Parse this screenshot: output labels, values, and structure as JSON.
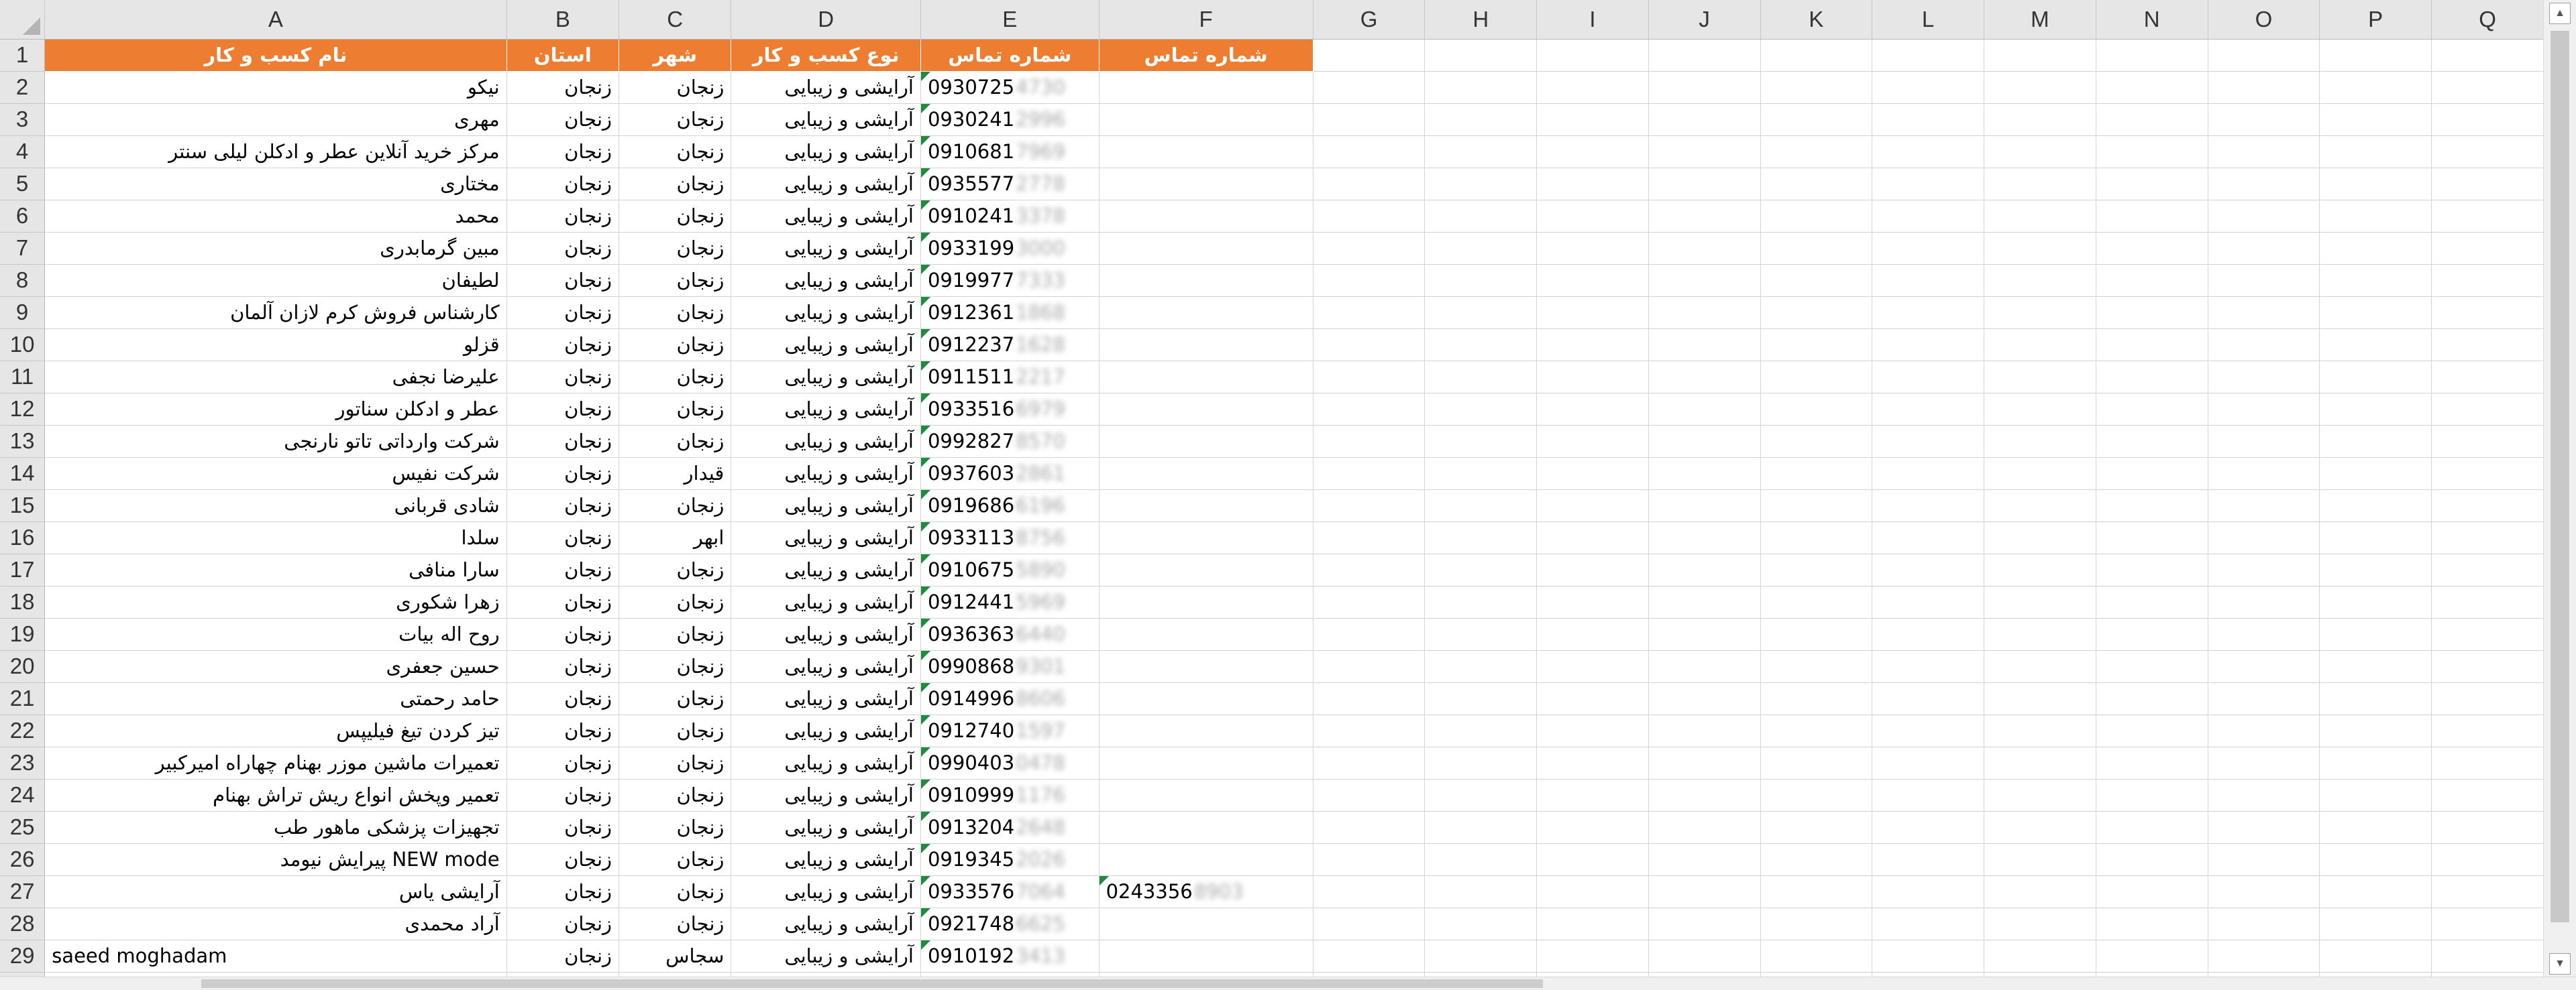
{
  "columns": [
    "A",
    "B",
    "C",
    "D",
    "E",
    "F",
    "G",
    "H",
    "I",
    "J",
    "K",
    "L",
    "M",
    "N",
    "O",
    "P",
    "Q"
  ],
  "selected_column": "A",
  "header_row": {
    "row_num": "1",
    "A": "نام کسب و کار",
    "B": "استان",
    "C": "شهر",
    "D": "نوع کسب و کار",
    "E": "شماره تماس",
    "F": "شماره تماس"
  },
  "rows": [
    {
      "num": "2",
      "name": "نیکو",
      "province": "زنجان",
      "city": "زنجان",
      "type": "آرایشی و زیبایی",
      "phone": "0930725",
      "phone_hidden": "4730",
      "phone2": "",
      "phone2_hidden": ""
    },
    {
      "num": "3",
      "name": "مهری",
      "province": "زنجان",
      "city": "زنجان",
      "type": "آرایشی و زیبایی",
      "phone": "0930241",
      "phone_hidden": "2996",
      "phone2": "",
      "phone2_hidden": ""
    },
    {
      "num": "4",
      "name": "مرکز خرید آنلاین عطر و ادکلن لیلی سنتر",
      "province": "زنجان",
      "city": "زنجان",
      "type": "آرایشی و زیبایی",
      "phone": "0910681",
      "phone_hidden": "7969",
      "phone2": "",
      "phone2_hidden": ""
    },
    {
      "num": "5",
      "name": "مختاری",
      "province": "زنجان",
      "city": "زنجان",
      "type": "آرایشی و زیبایی",
      "phone": "0935577",
      "phone_hidden": "2778",
      "phone2": "",
      "phone2_hidden": ""
    },
    {
      "num": "6",
      "name": "محمد",
      "province": "زنجان",
      "city": "زنجان",
      "type": "آرایشی و زیبایی",
      "phone": "0910241",
      "phone_hidden": "3378",
      "phone2": "",
      "phone2_hidden": ""
    },
    {
      "num": "7",
      "name": "مبین گرمابدری",
      "province": "زنجان",
      "city": "زنجان",
      "type": "آرایشی و زیبایی",
      "phone": "0933199",
      "phone_hidden": "3000",
      "phone2": "",
      "phone2_hidden": ""
    },
    {
      "num": "8",
      "name": "لطیفان",
      "province": "زنجان",
      "city": "زنجان",
      "type": "آرایشی و زیبایی",
      "phone": "0919977",
      "phone_hidden": "7333",
      "phone2": "",
      "phone2_hidden": ""
    },
    {
      "num": "9",
      "name": "کارشناس فروش کرم لازان آلمان",
      "province": "زنجان",
      "city": "زنجان",
      "type": "آرایشی و زیبایی",
      "phone": "0912361",
      "phone_hidden": "1868",
      "phone2": "",
      "phone2_hidden": ""
    },
    {
      "num": "10",
      "name": "قزلو",
      "province": "زنجان",
      "city": "زنجان",
      "type": "آرایشی و زیبایی",
      "phone": "0912237",
      "phone_hidden": "1628",
      "phone2": "",
      "phone2_hidden": ""
    },
    {
      "num": "11",
      "name": "علیرضا نجفی",
      "province": "زنجان",
      "city": "زنجان",
      "type": "آرایشی و زیبایی",
      "phone": "0911511",
      "phone_hidden": "2217",
      "phone2": "",
      "phone2_hidden": ""
    },
    {
      "num": "12",
      "name": "عطر و ادکلن سناتور",
      "province": "زنجان",
      "city": "زنجان",
      "type": "آرایشی و زیبایی",
      "phone": "0933516",
      "phone_hidden": "6979",
      "phone2": "",
      "phone2_hidden": ""
    },
    {
      "num": "13",
      "name": "شرکت وارداتی تاتو نارنجی",
      "province": "زنجان",
      "city": "زنجان",
      "type": "آرایشی و زیبایی",
      "phone": "0992827",
      "phone_hidden": "8570",
      "phone2": "",
      "phone2_hidden": ""
    },
    {
      "num": "14",
      "name": "شرکت نفیس",
      "province": "زنجان",
      "city": "قیدار",
      "type": "آرایشی و زیبایی",
      "phone": "0937603",
      "phone_hidden": "2861",
      "phone2": "",
      "phone2_hidden": ""
    },
    {
      "num": "15",
      "name": "شادی قربانی",
      "province": "زنجان",
      "city": "زنجان",
      "type": "آرایشی و زیبایی",
      "phone": "0919686",
      "phone_hidden": "6196",
      "phone2": "",
      "phone2_hidden": ""
    },
    {
      "num": "16",
      "name": "سلدا",
      "province": "زنجان",
      "city": "ابهر",
      "type": "آرایشی و زیبایی",
      "phone": "0933113",
      "phone_hidden": "8756",
      "phone2": "",
      "phone2_hidden": ""
    },
    {
      "num": "17",
      "name": "سارا منافی",
      "province": "زنجان",
      "city": "زنجان",
      "type": "آرایشی و زیبایی",
      "phone": "0910675",
      "phone_hidden": "5890",
      "phone2": "",
      "phone2_hidden": ""
    },
    {
      "num": "18",
      "name": "زهرا شکوری",
      "province": "زنجان",
      "city": "زنجان",
      "type": "آرایشی و زیبایی",
      "phone": "0912441",
      "phone_hidden": "5969",
      "phone2": "",
      "phone2_hidden": ""
    },
    {
      "num": "19",
      "name": "روح اله بیات",
      "province": "زنجان",
      "city": "زنجان",
      "type": "آرایشی و زیبایی",
      "phone": "0936363",
      "phone_hidden": "6440",
      "phone2": "",
      "phone2_hidden": ""
    },
    {
      "num": "20",
      "name": "حسین جعفری",
      "province": "زنجان",
      "city": "زنجان",
      "type": "آرایشی و زیبایی",
      "phone": "0990868",
      "phone_hidden": "9301",
      "phone2": "",
      "phone2_hidden": ""
    },
    {
      "num": "21",
      "name": "حامد رحمتی",
      "province": "زنجان",
      "city": "زنجان",
      "type": "آرایشی و زیبایی",
      "phone": "0914996",
      "phone_hidden": "8606",
      "phone2": "",
      "phone2_hidden": ""
    },
    {
      "num": "22",
      "name": "تیز کردن تیغ فیلیپس",
      "province": "زنجان",
      "city": "زنجان",
      "type": "آرایشی و زیبایی",
      "phone": "0912740",
      "phone_hidden": "1597",
      "phone2": "",
      "phone2_hidden": ""
    },
    {
      "num": "23",
      "name": "تعمیرات ماشین موزر بهنام چهاراه امیرکبیر",
      "province": "زنجان",
      "city": "زنجان",
      "type": "آرایشی و زیبایی",
      "phone": "0990403",
      "phone_hidden": "0478",
      "phone2": "",
      "phone2_hidden": ""
    },
    {
      "num": "24",
      "name": "تعمیر وپخش انواع ریش تراش بهنام",
      "province": "زنجان",
      "city": "زنجان",
      "type": "آرایشی و زیبایی",
      "phone": "0910999",
      "phone_hidden": "1176",
      "phone2": "",
      "phone2_hidden": ""
    },
    {
      "num": "25",
      "name": "تجهیزات پزشکی ماهور طب",
      "province": "زنجان",
      "city": "زنجان",
      "type": "آرایشی و زیبایی",
      "phone": "0913204",
      "phone_hidden": "2648",
      "phone2": "",
      "phone2_hidden": ""
    },
    {
      "num": "26",
      "name": "پیرایش نیومد  NEW mode",
      "province": "زنجان",
      "city": "زنجان",
      "type": "آرایشی و زیبایی",
      "phone": "0919345",
      "phone_hidden": "2026",
      "phone2": "",
      "phone2_hidden": ""
    },
    {
      "num": "27",
      "name": "آرایشی یاس",
      "province": "زنجان",
      "city": "زنجان",
      "type": "آرایشی و زیبایی",
      "phone": "0933576",
      "phone_hidden": "7064",
      "phone2": "0243356",
      "phone2_hidden": "8903"
    },
    {
      "num": "28",
      "name": "آراد محمدی",
      "province": "زنجان",
      "city": "زنجان",
      "type": "آرایشی و زیبایی",
      "phone": "0921748",
      "phone_hidden": "6625",
      "phone2": "",
      "phone2_hidden": ""
    },
    {
      "num": "29",
      "name": "saeed moghadam",
      "province": "زنجان",
      "city": "سجاس",
      "type": "آرایشی و زیبایی",
      "phone": "0910192",
      "phone_hidden": "3413",
      "phone2": "",
      "phone2_hidden": ""
    }
  ],
  "colors": {
    "header_fill": "#ed7d31",
    "header_text": "#ffffff",
    "comment_marker": "#1e8c3c",
    "selection_accent": "#217346"
  }
}
